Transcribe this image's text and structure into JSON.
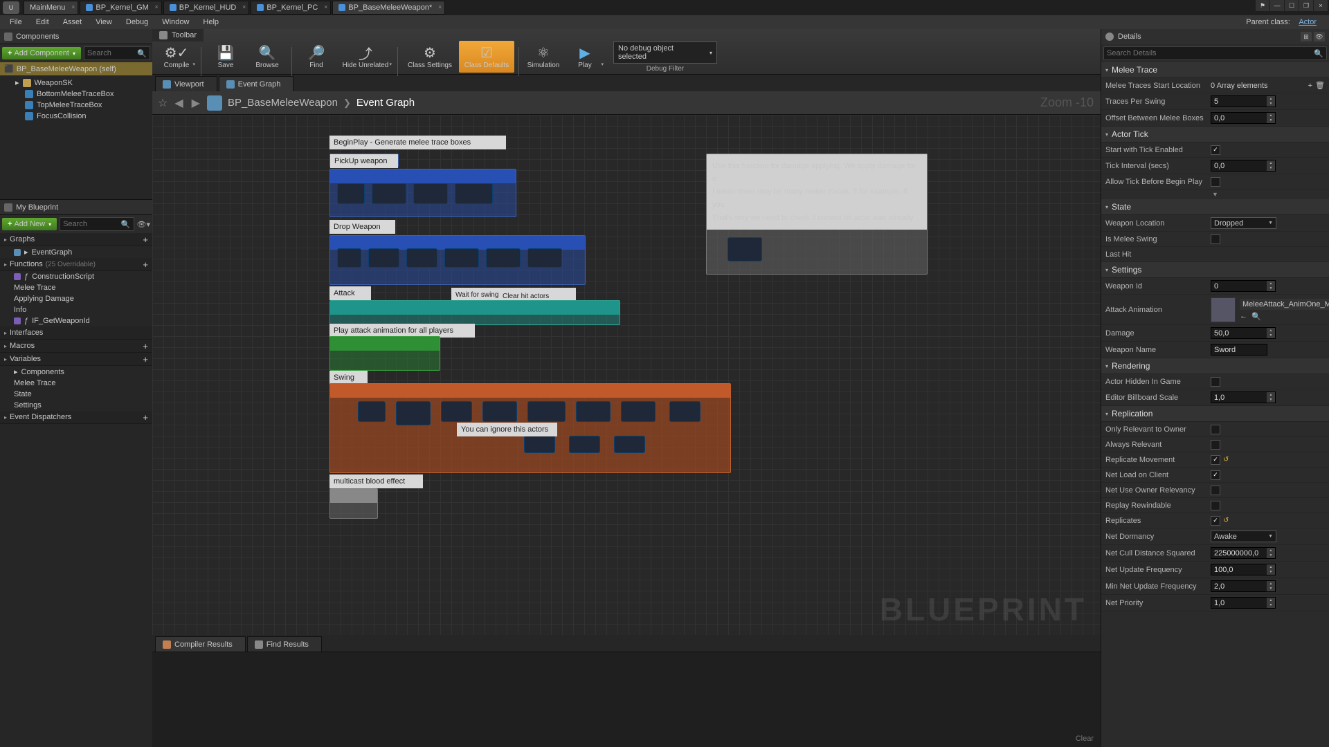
{
  "tabs": {
    "main": "MainMenu",
    "t1": "BP_Kernel_GM",
    "t2": "BP_Kernel_HUD",
    "t3": "BP_Kernel_PC",
    "t4": "BP_BaseMeleeWeapon*"
  },
  "menu": [
    "File",
    "Edit",
    "Asset",
    "View",
    "Debug",
    "Window",
    "Help"
  ],
  "parentClass": {
    "label": "Parent class:",
    "value": "Actor"
  },
  "componentsPanel": {
    "title": "Components",
    "addBtn": "Add Component",
    "searchPh": "Search",
    "self": "BP_BaseMeleeWeapon (self)",
    "items": [
      "WeaponSK",
      "BottomMeleeTraceBox",
      "TopMeleeTraceBox",
      "FocusCollision"
    ]
  },
  "myBlueprint": {
    "title": "My Blueprint",
    "addBtn": "Add New",
    "searchPh": "Search",
    "graphs": {
      "label": "Graphs",
      "items": [
        "EventGraph"
      ]
    },
    "functions": {
      "label": "Functions",
      "count": "(25 Overridable)",
      "items": [
        "ConstructionScript",
        "Melee Trace",
        "Applying Damage",
        "Info",
        "IF_GetWeaponId"
      ]
    },
    "interfaces": "Interfaces",
    "macros": "Macros",
    "variables": {
      "label": "Variables",
      "items": [
        "Components",
        "Melee Trace",
        "State",
        "Settings"
      ]
    },
    "dispatchers": "Event Dispatchers"
  },
  "toolbar": {
    "title": "Toolbar",
    "compile": "Compile",
    "save": "Save",
    "browse": "Browse",
    "find": "Find",
    "hide": "Hide Unrelated",
    "classSettings": "Class Settings",
    "classDefaults": "Class Defaults",
    "simulation": "Simulation",
    "play": "Play",
    "debugSel": "No debug object selected",
    "debugFilter": "Debug Filter"
  },
  "graphTabs": {
    "viewport": "Viewport",
    "eventGraph": "Event Graph"
  },
  "crumb": {
    "bp": "BP_BaseMeleeWeapon",
    "cur": "Event Graph",
    "zoom": "Zoom -10"
  },
  "comments": {
    "c1": "BeginPlay - Generate melee trace boxes",
    "c2": "PickUp weapon",
    "c3": "Drop Weapon",
    "c4": "Attack",
    "c5": "Wait for swing animation start",
    "c5b": "Clear hit actors",
    "c6": "Play attack animation for all players",
    "c7": "Swing",
    "c8": "You can ignore this actors",
    "c9": "multicast blood effect",
    "note1": "Use this function for damage applying. We apply damage for o",
    "note2": "I mean there may be many melee traces, 5 for example. If you",
    "note3": "That's why we need to check if current hit actor was already"
  },
  "bottom": {
    "compiler": "Compiler Results",
    "find": "Find Results",
    "clear": "Clear"
  },
  "details": {
    "title": "Details",
    "searchPh": "Search Details",
    "meleeTrace": {
      "title": "Melee Trace",
      "startLoc": {
        "label": "Melee Traces Start Location",
        "val": "0 Array elements"
      },
      "perSwing": {
        "label": "Traces Per Swing",
        "val": "5"
      },
      "offset": {
        "label": "Offset Between Melee Boxes",
        "val": "0,0"
      }
    },
    "actorTick": {
      "title": "Actor Tick",
      "start": {
        "label": "Start with Tick Enabled",
        "checked": true
      },
      "interval": {
        "label": "Tick Interval (secs)",
        "val": "0,0"
      },
      "allow": {
        "label": "Allow Tick Before Begin Play",
        "checked": false
      }
    },
    "state": {
      "title": "State",
      "loc": {
        "label": "Weapon Location",
        "val": "Dropped"
      },
      "swing": {
        "label": "Is Melee Swing",
        "checked": false
      },
      "last": {
        "label": "Last Hit"
      }
    },
    "settings": {
      "title": "Settings",
      "id": {
        "label": "Weapon Id",
        "val": "0"
      },
      "anim": {
        "label": "Attack Animation",
        "val": "MeleeAttack_AnimOne_Montage"
      },
      "damage": {
        "label": "Damage",
        "val": "50,0"
      },
      "name": {
        "label": "Weapon Name",
        "val": "Sword"
      }
    },
    "rendering": {
      "title": "Rendering",
      "hidden": {
        "label": "Actor Hidden In Game",
        "checked": false
      },
      "billboard": {
        "label": "Editor Billboard Scale",
        "val": "1,0"
      }
    },
    "replication": {
      "title": "Replication",
      "onlyOwner": {
        "label": "Only Relevant to Owner",
        "checked": false
      },
      "always": {
        "label": "Always Relevant",
        "checked": false
      },
      "move": {
        "label": "Replicate Movement",
        "checked": true
      },
      "netload": {
        "label": "Net Load on Client",
        "checked": true
      },
      "useOwner": {
        "label": "Net Use Owner Relevancy",
        "checked": false
      },
      "rewind": {
        "label": "Replay Rewindable",
        "checked": false
      },
      "replicates": {
        "label": "Replicates",
        "checked": true
      },
      "dormancy": {
        "label": "Net Dormancy",
        "val": "Awake"
      },
      "cull": {
        "label": "Net Cull Distance Squared",
        "val": "225000000,0"
      },
      "updFreq": {
        "label": "Net Update Frequency",
        "val": "100,0"
      },
      "minUpd": {
        "label": "Min Net Update Frequency",
        "val": "2,0"
      },
      "prio": {
        "label": "Net Priority",
        "val": "1,0"
      }
    }
  },
  "watermark": "BLUEPRINT"
}
